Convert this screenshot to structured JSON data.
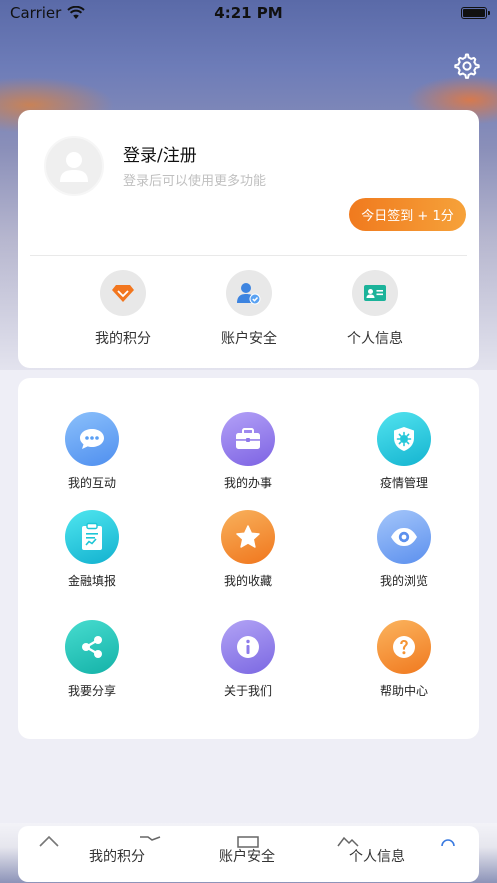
{
  "status_bar": {
    "carrier": "Carrier",
    "time": "4:21 PM"
  },
  "profile": {
    "title": "登录/注册",
    "subtitle": "登录后可以使用更多功能",
    "checkin_label": "今日签到 + 1分"
  },
  "quick_links": [
    {
      "label": "我的积分",
      "icon": "diamond-icon"
    },
    {
      "label": "账户安全",
      "icon": "user-shield-icon"
    },
    {
      "label": "个人信息",
      "icon": "id-card-icon"
    }
  ],
  "menu": [
    {
      "label": "我的互动",
      "icon": "chat-icon",
      "color": "#5aa0f5"
    },
    {
      "label": "我的办事",
      "icon": "briefcase-icon",
      "color": "#8f78ea"
    },
    {
      "label": "疫情管理",
      "icon": "virus-shield-icon",
      "color": "#23c7d9"
    },
    {
      "label": "金融填报",
      "icon": "clipboard-icon",
      "color": "#1cc6d6"
    },
    {
      "label": "我的收藏",
      "icon": "star-icon",
      "color": "#f38a2a"
    },
    {
      "label": "我的浏览",
      "icon": "eye-icon",
      "color": "#6a9ef2"
    },
    {
      "label": "我要分享",
      "icon": "share-icon",
      "color": "#22c2b7"
    },
    {
      "label": "关于我们",
      "icon": "info-icon",
      "color": "#8d7cea"
    },
    {
      "label": "帮助中心",
      "icon": "question-icon",
      "color": "#f59433"
    }
  ],
  "bottom_ghost": {
    "labels": [
      "我的积分",
      "账户安全",
      "个人信息"
    ]
  }
}
